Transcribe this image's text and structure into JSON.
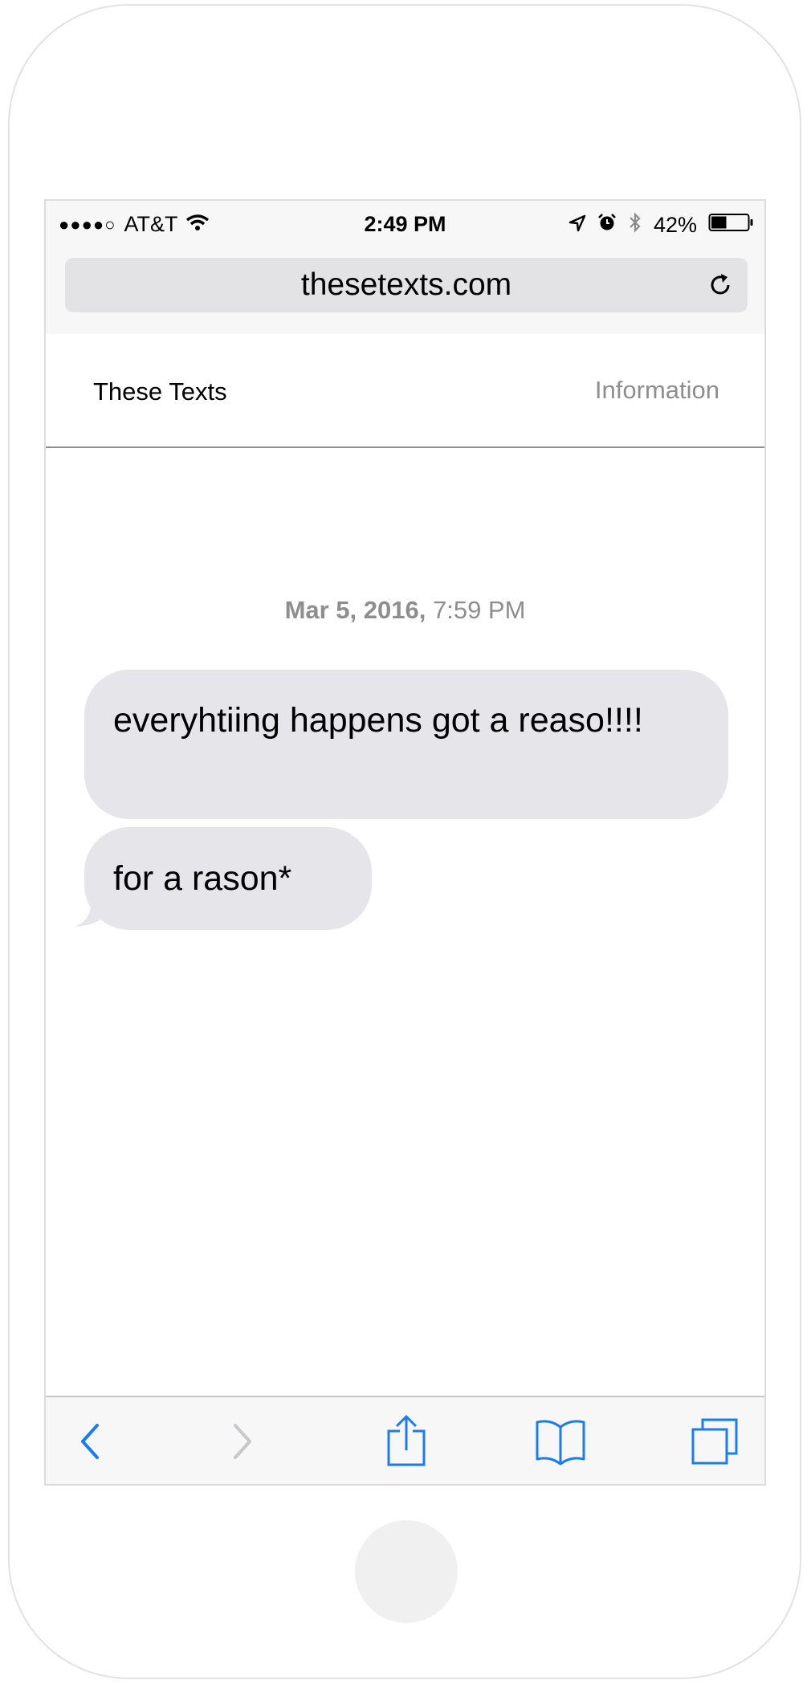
{
  "status_bar": {
    "signal": "●●●●○",
    "carrier": "AT&T",
    "time": "2:49 PM",
    "battery": "42%",
    "battery_level": 0.42
  },
  "browser": {
    "url": "thesetexts.com"
  },
  "site_nav": {
    "brand": "These Texts",
    "info_link": "Information"
  },
  "conversation": {
    "date": "Mar 5, 2016,",
    "time": "7:59 PM",
    "messages": [
      "everyhtiing happens got a reaso!!!!",
      "for a rason*"
    ]
  },
  "toolbar": {
    "icons": [
      "back-icon",
      "forward-icon",
      "share-icon",
      "bookmarks-icon",
      "tabs-icon"
    ],
    "accent_color": "#1a7cf5",
    "disabled_color": "#c7c7cc"
  }
}
